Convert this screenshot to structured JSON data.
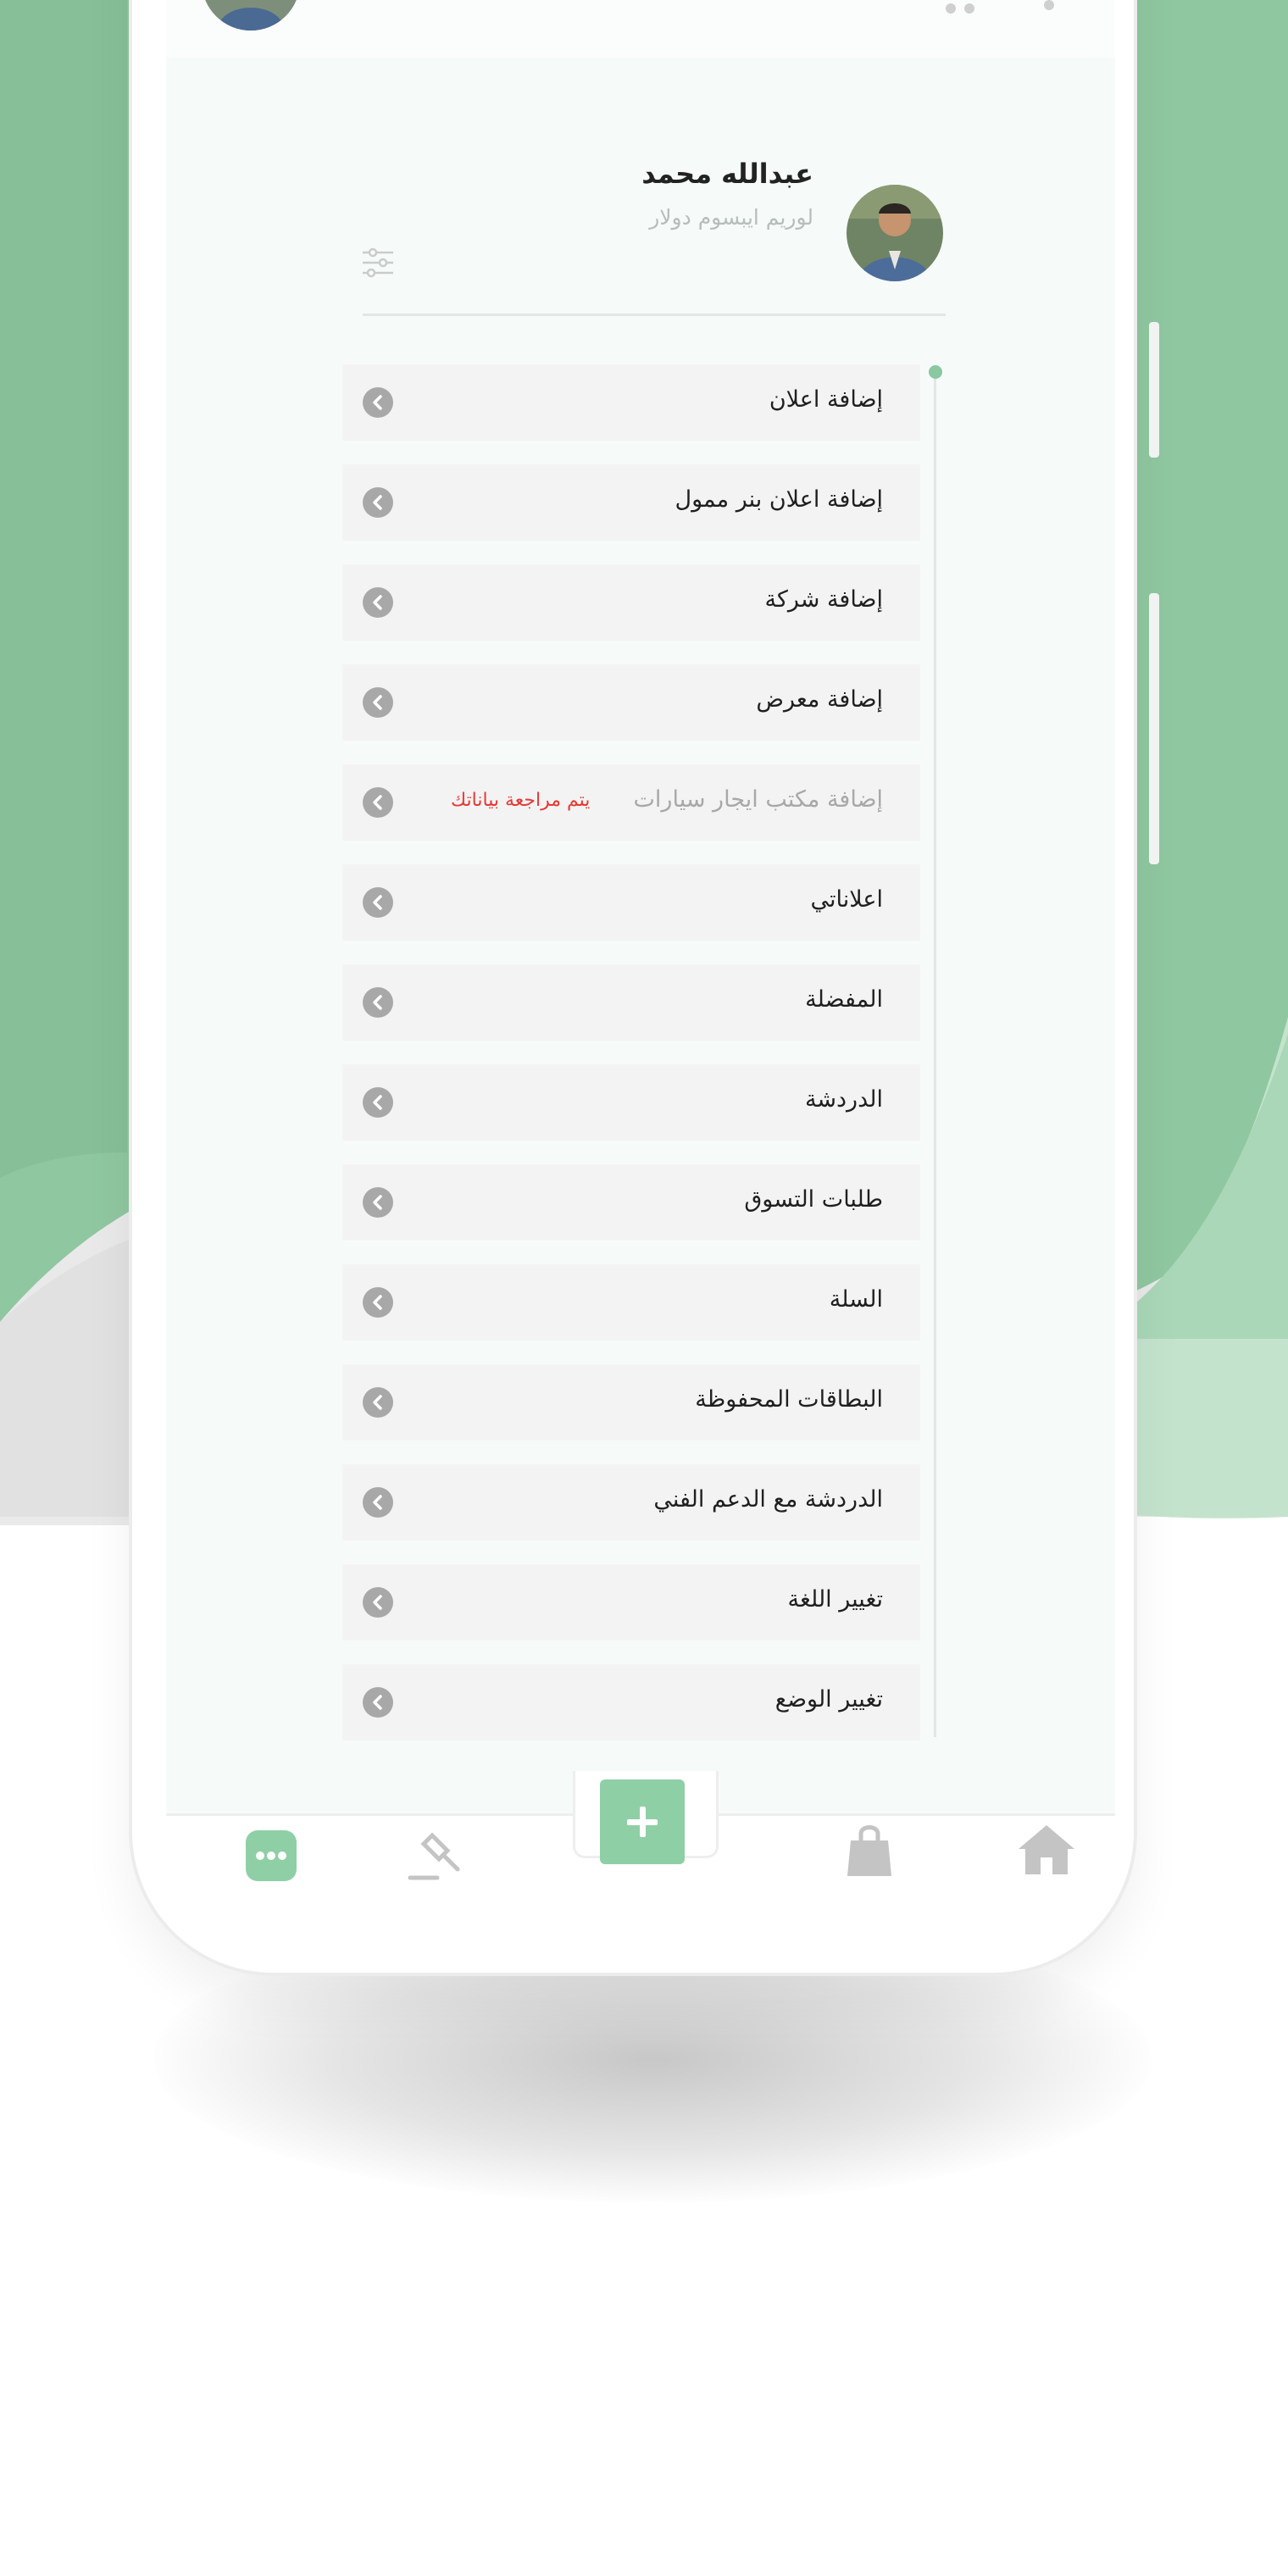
{
  "profile": {
    "name": "عبدالله محمد",
    "subtitle": "لوريم ايبسوم دولار"
  },
  "menu": {
    "items": [
      {
        "label": "إضافة اعلان"
      },
      {
        "label": "إضافة اعلان بنر ممول"
      },
      {
        "label": "إضافة شركة"
      },
      {
        "label": "إضافة معرض"
      },
      {
        "label": "إضافة مكتب ايجار سيارات",
        "status": "يتم مراجعة بياناتك",
        "disabled": true
      },
      {
        "label": "اعلاناتي"
      },
      {
        "label": "المفضلة"
      },
      {
        "label": "الدردشة"
      },
      {
        "label": "طلبات التسوق"
      },
      {
        "label": "السلة"
      },
      {
        "label": "البطاقات المحفوظة"
      },
      {
        "label": "الدردشة مع الدعم الفني"
      },
      {
        "label": "تغيير اللغة"
      },
      {
        "label": "تغيير الوضع"
      }
    ]
  },
  "icons": {
    "topbar": [
      "avatar",
      "logo",
      "cart-icon",
      "bell-icon"
    ],
    "profile": [
      "filter-icon"
    ],
    "menu_item": "chevron-left-icon",
    "bottom_nav": [
      "more-icon",
      "auction-icon",
      "add-icon",
      "shopping-bag-icon",
      "home-icon"
    ]
  },
  "colors": {
    "accent": "#8fcfa6",
    "accent_dark": "#89c8a0",
    "background_green": "#8fc7a0",
    "status_red": "#e53935",
    "menu_item_bg": "#f3f3f3",
    "icon_gray": "#c4c4c4"
  }
}
